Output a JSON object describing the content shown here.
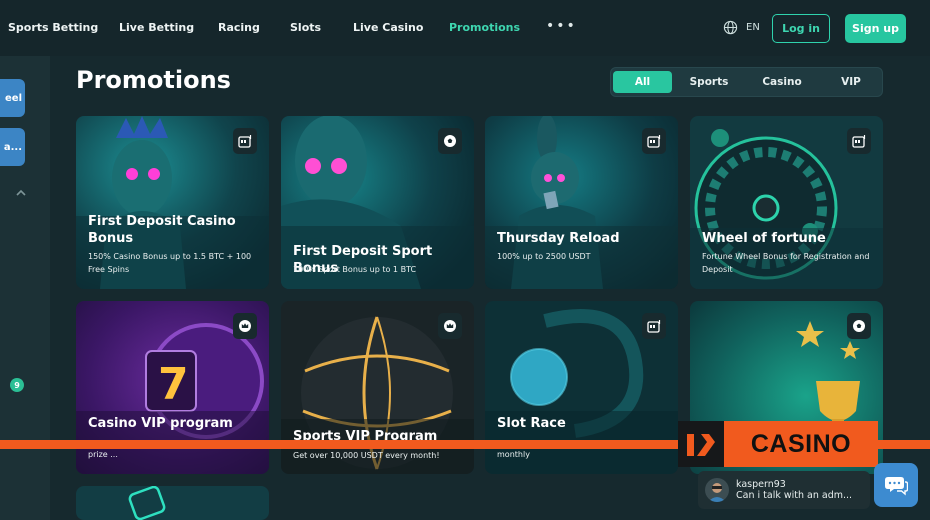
{
  "nav": {
    "items": [
      {
        "label": "Sports Betting"
      },
      {
        "label": "Live Betting"
      },
      {
        "label": "Racing"
      },
      {
        "label": "Slots"
      },
      {
        "label": "Live Casino"
      },
      {
        "label": "Promotions",
        "active": true
      }
    ],
    "more_icon": "more-dots-icon",
    "language": "EN",
    "login_label": "Log in",
    "signup_label": "Sign up"
  },
  "sidebar": {
    "buttons": [
      {
        "label": "eel"
      },
      {
        "label": "a..."
      }
    ],
    "badge_count": "9"
  },
  "page": {
    "title": "Promotions",
    "filters": [
      "All",
      "Sports",
      "Casino",
      "VIP"
    ],
    "active_filter": "All"
  },
  "cards": [
    {
      "title": "First Deposit Casino Bonus",
      "desc": "150% Casino Bonus up to 1.5 BTC + 100 Free Spins",
      "icon": "slot-machine-icon"
    },
    {
      "title": "First Deposit Sport Bonus",
      "desc": "100% Sport Bonus up to 1 BTC",
      "icon": "soccer-ball-icon"
    },
    {
      "title": "Thursday Reload",
      "desc": "100% up to 2500 USDT",
      "icon": "slot-machine-icon"
    },
    {
      "title": "Wheel of fortune",
      "desc": "Fortune Wheel Bonus for Registration and Deposit",
      "icon": "slot-machine-icon"
    },
    {
      "title": "Casino VIP program",
      "desc": "prize ...",
      "icon": "crown-icon"
    },
    {
      "title": "Sports VIP Program",
      "desc": "Get over 10,000 USDT every month!",
      "icon": "crown-icon"
    },
    {
      "title": "Slot Race",
      "desc": "monthly",
      "icon": "slot-machine-icon"
    },
    {
      "title": "",
      "desc": "",
      "icon": "soccer-ball-icon"
    }
  ],
  "ad": {
    "brand": "CASINO"
  },
  "chat": {
    "username": "kaspern93",
    "message": "Can i talk with an adm..."
  },
  "colors": {
    "accent": "#29c6a0",
    "background": "#16292e",
    "banner": "#f15a1e",
    "chat_button": "#3d8bd0"
  }
}
